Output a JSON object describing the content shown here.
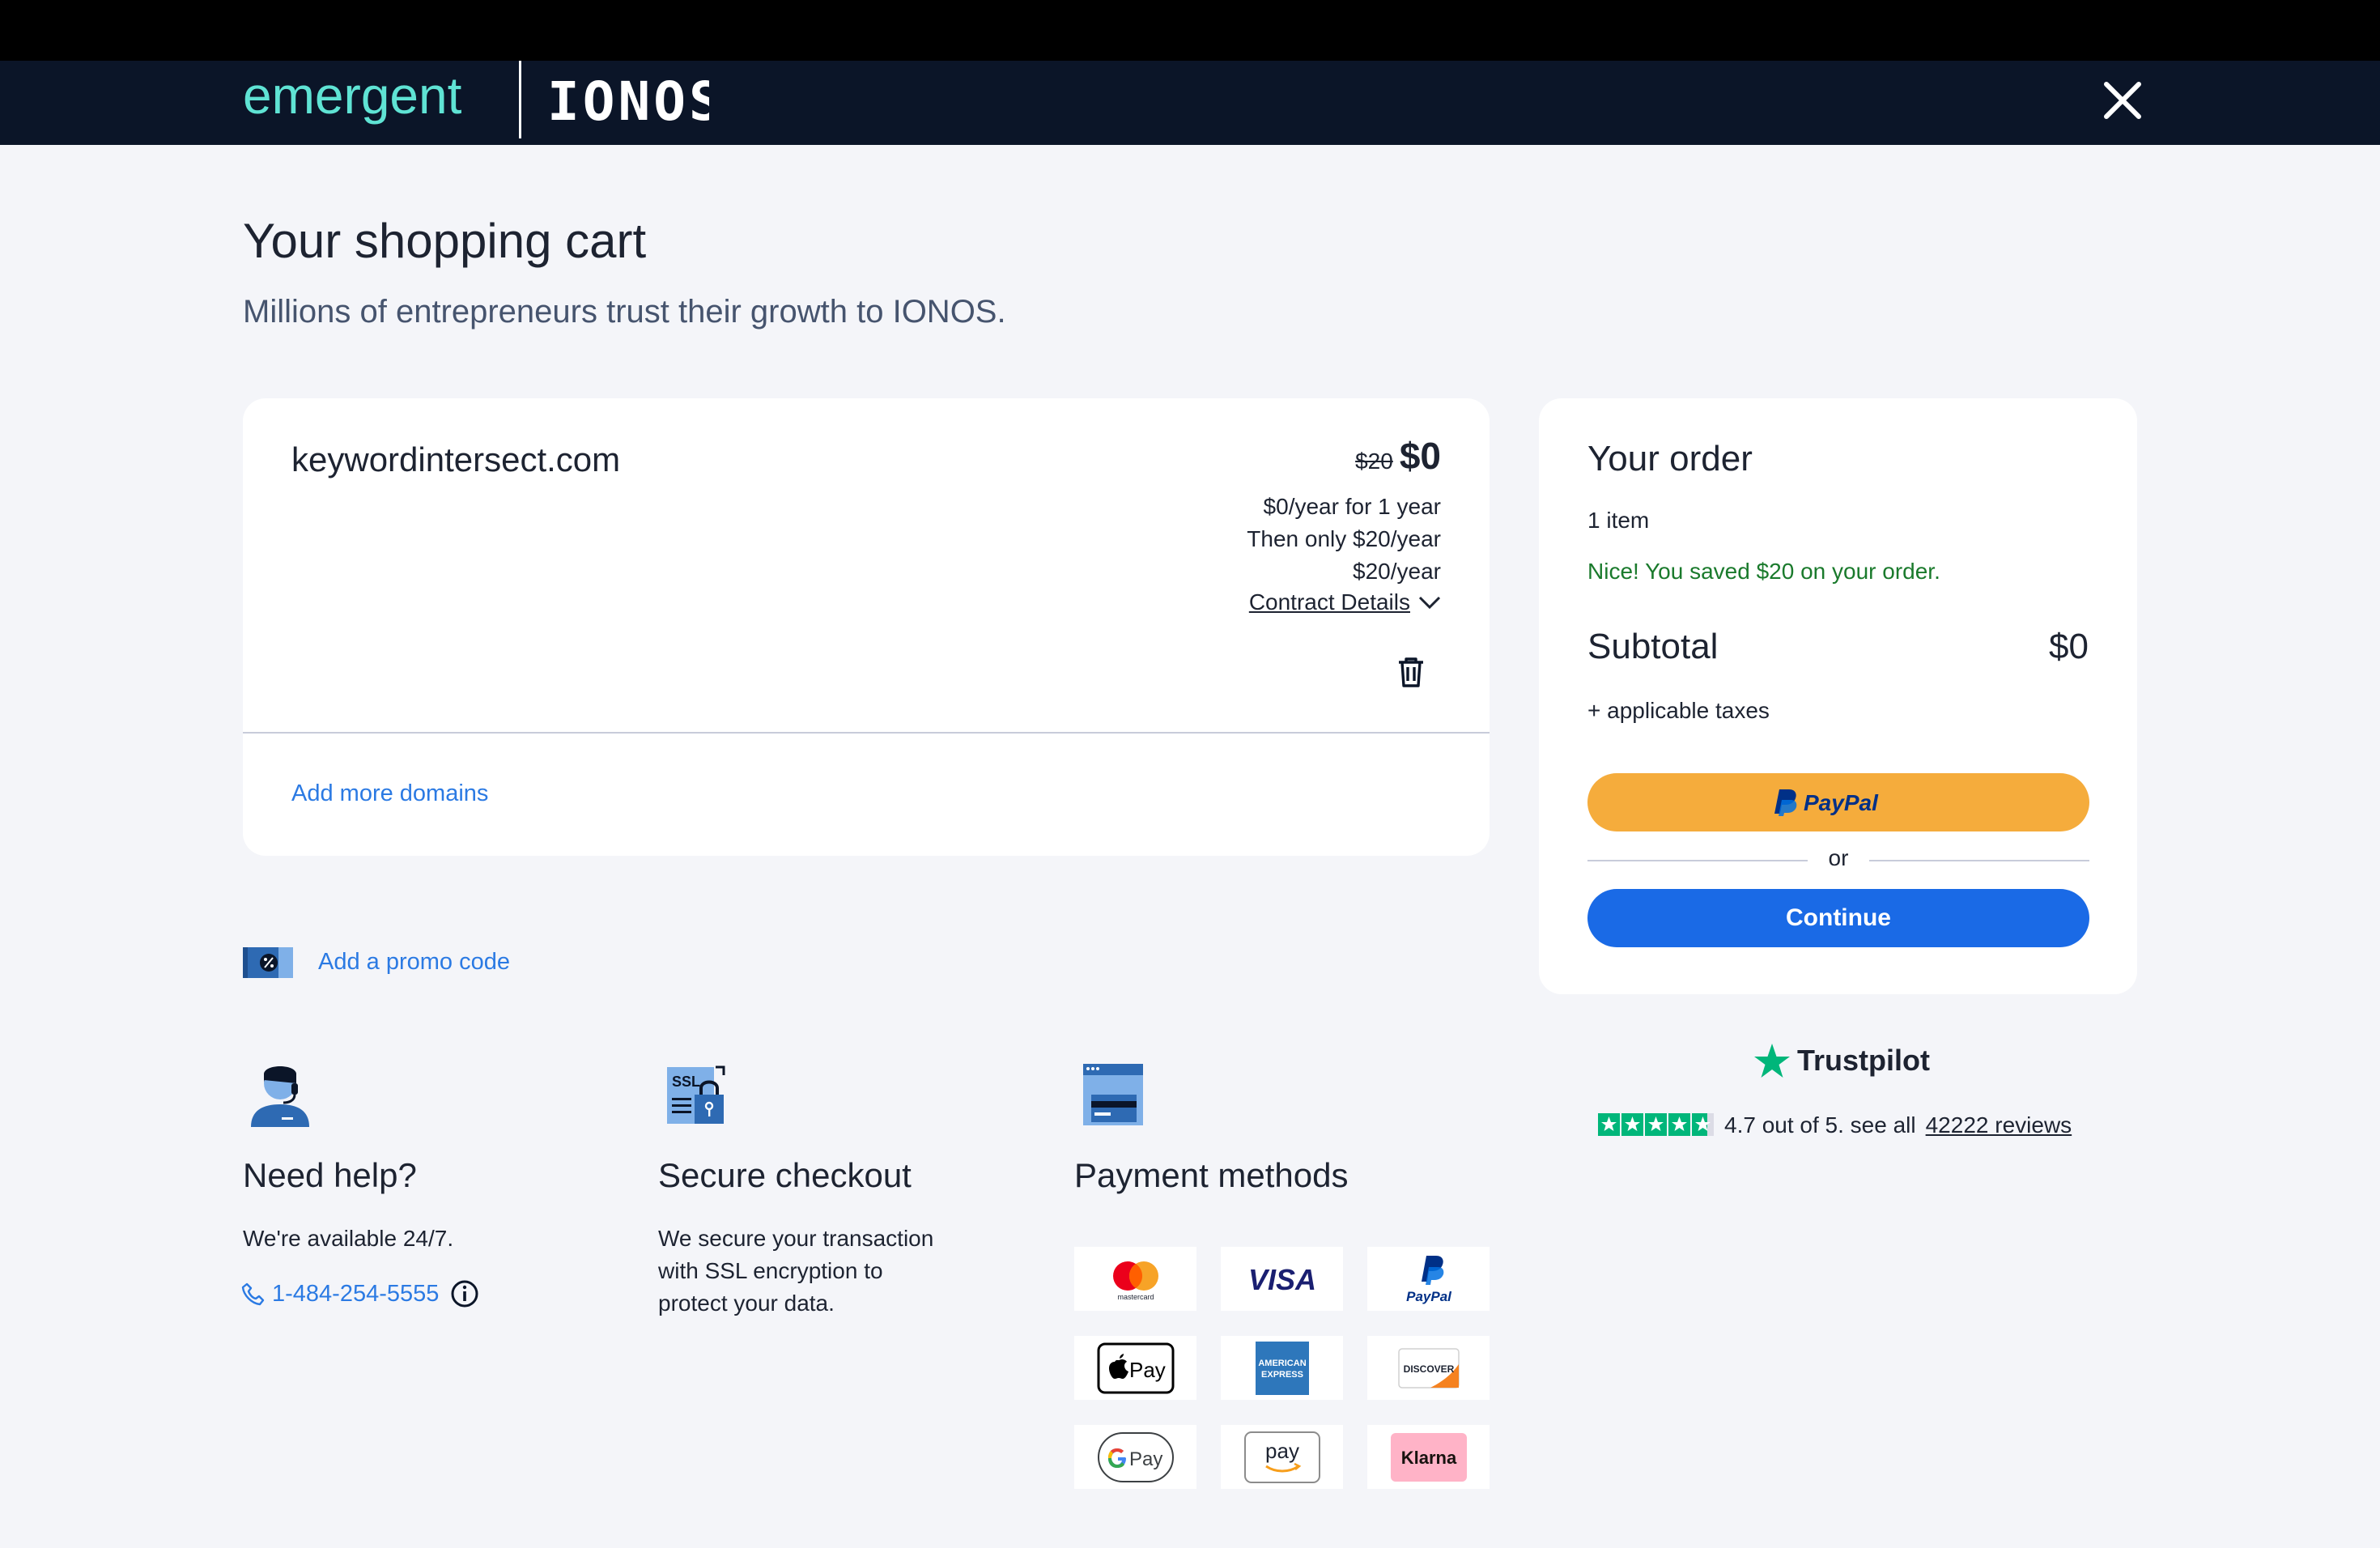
{
  "header": {
    "brand_primary": "emergent",
    "brand_secondary": "IONOS",
    "brand_color": "#5fe3d4"
  },
  "page": {
    "title": "Your shopping cart",
    "subtitle": "Millions of entrepreneurs trust their growth to IONOS."
  },
  "cart": {
    "domain": "keywordintersect.com",
    "price_old": "$20",
    "price_new": "$0",
    "price_term": "$0/year for 1 year",
    "price_then": "Then only $20/year",
    "price_regular": "$20/year",
    "contract_details": "Contract Details",
    "add_more": "Add more domains"
  },
  "promo": {
    "label": "Add a promo code"
  },
  "order": {
    "title": "Your order",
    "count": "1 item",
    "saved": "Nice! You saved $20 on your order.",
    "subtotal_label": "Subtotal",
    "subtotal_value": "$0",
    "taxes": "+ applicable taxes",
    "paypal_label": "PayPal",
    "or": "or",
    "continue": "Continue"
  },
  "trustpilot": {
    "name": "Trustpilot",
    "rating_text": "4.7 out of 5. see all",
    "reviews_link": "42222 reviews",
    "rating": 4.7
  },
  "help": {
    "title": "Need help?",
    "text": "We're available 24/7.",
    "phone": "1-484-254-5555"
  },
  "secure": {
    "title": "Secure checkout",
    "line1": "We secure your transaction",
    "line2": "with SSL encryption to",
    "line3": "protect your data.",
    "ssl_badge": "SSL"
  },
  "payments": {
    "title": "Payment methods",
    "mastercard": "mastercard",
    "visa": "VISA",
    "paypal": "PayPal",
    "applepay": "Pay",
    "amex_1": "AMERICAN",
    "amex_2": "EXPRESS",
    "discover": "DISCOVER",
    "gpay": "Pay",
    "amazon": "pay",
    "klarna": "Klarna"
  },
  "colors": {
    "accent_blue": "#1a6ae6",
    "link_blue": "#2b7ae3",
    "paypal_yellow": "#f5ac3c",
    "success_green": "#1a7a2c",
    "trust_green": "#00b67a"
  }
}
